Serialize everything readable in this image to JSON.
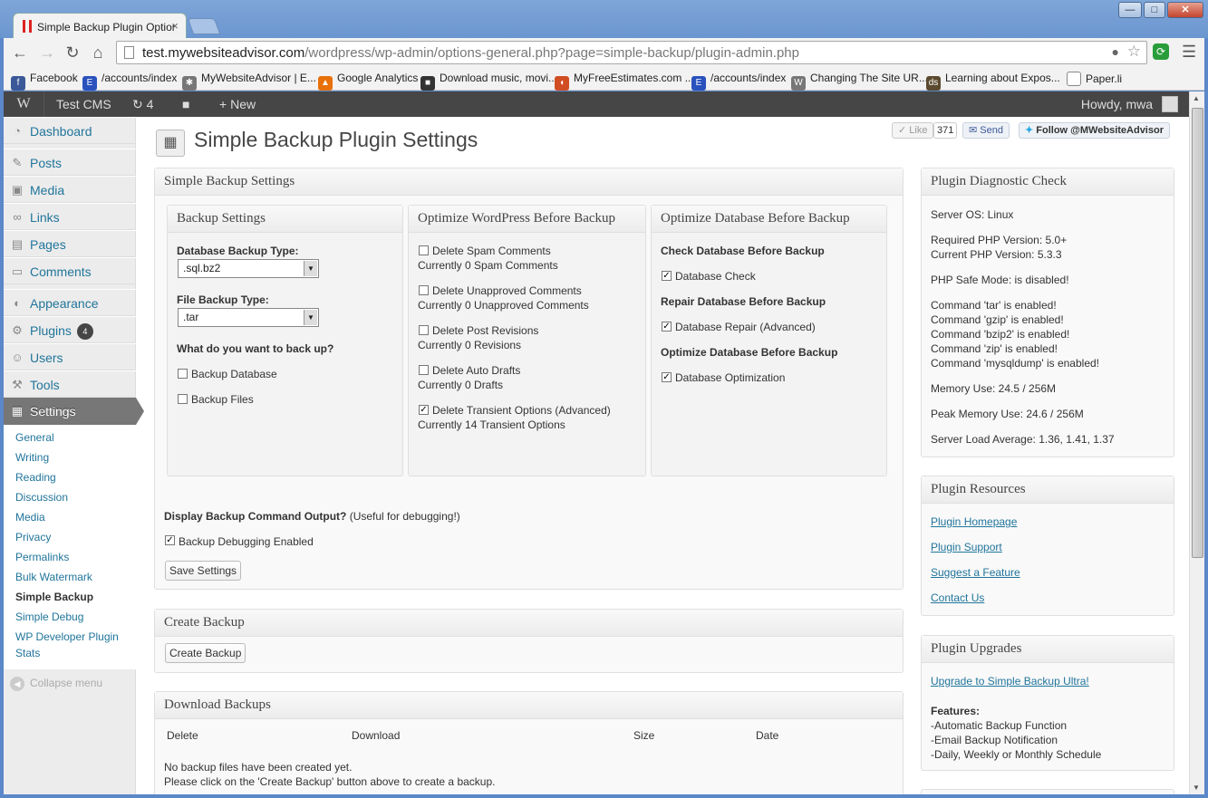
{
  "browser": {
    "tab_title": "Simple Backup Plugin Options",
    "tab_close": "×",
    "url_host": "test.mywebsiteadvisor.com",
    "url_path": "/wordpress/wp-admin/options-general.php?page=simple-backup/plugin-admin.php",
    "bookmarks": [
      {
        "label": "Facebook",
        "icon": "facebook-icon",
        "color": "#3b5998"
      },
      {
        "label": "/accounts/index",
        "icon": "e-icon",
        "color": "#2a52be"
      },
      {
        "label": "MyWebsiteAdvisor | E...",
        "icon": "gear-icon",
        "color": "#777777"
      },
      {
        "label": "Google Analytics",
        "icon": "analytics-icon",
        "color": "#e8710a"
      },
      {
        "label": "Download music, movi...",
        "icon": "pirate-icon",
        "color": "#333333"
      },
      {
        "label": "MyFreeEstimates.com ...",
        "icon": "estimates-icon",
        "color": "#d14d22"
      },
      {
        "label": "/accounts/index",
        "icon": "e-icon",
        "color": "#2a52be"
      },
      {
        "label": "Changing The Site UR...",
        "icon": "wordpress-icon",
        "color": "#777777"
      },
      {
        "label": "Learning about Expos...",
        "icon": "ds-icon",
        "color": "#5b4a2f"
      },
      {
        "label": "Paper.li",
        "icon": "page-icon",
        "color": "#ffffff"
      }
    ]
  },
  "adminbar": {
    "site_name": "Test CMS",
    "updates_count": "4",
    "new_label": "New",
    "howdy": "Howdy, mwa"
  },
  "sidebar": {
    "menu": [
      {
        "label": "Dashboard",
        "icon": "dashboard-icon"
      },
      {
        "label": "Posts",
        "icon": "pin-icon"
      },
      {
        "label": "Media",
        "icon": "media-icon"
      },
      {
        "label": "Links",
        "icon": "link-icon"
      },
      {
        "label": "Pages",
        "icon": "pages-icon"
      },
      {
        "label": "Comments",
        "icon": "comment-icon"
      },
      {
        "label": "Appearance",
        "icon": "appearance-icon"
      },
      {
        "label": "Plugins",
        "icon": "plugin-icon",
        "badge": "4"
      },
      {
        "label": "Users",
        "icon": "users-icon"
      },
      {
        "label": "Tools",
        "icon": "tools-icon"
      },
      {
        "label": "Settings",
        "icon": "settings-icon"
      }
    ],
    "submenu": [
      "General",
      "Writing",
      "Reading",
      "Discussion",
      "Media",
      "Privacy",
      "Permalinks",
      "Bulk Watermark",
      "Simple Backup",
      "Simple Debug",
      "WP Developer Plugin",
      "Stats"
    ],
    "collapse_label": "Collapse menu"
  },
  "header": {
    "title": "Simple Backup Plugin Settings",
    "like_label": "Like",
    "like_count": "371",
    "send_label": "Send",
    "follow_label": "Follow @MWebsiteAdvisor"
  },
  "settings_box": {
    "title": "Simple Backup Settings",
    "backup": {
      "title": "Backup Settings",
      "db_type_label": "Database Backup Type:",
      "db_type_value": ".sql.bz2",
      "file_type_label": "File Backup Type:",
      "file_type_value": ".tar",
      "what_label": "What do you want to back up?",
      "opt_database": "Backup Database",
      "opt_files": "Backup Files"
    },
    "optimize_wp": {
      "title": "Optimize WordPress Before Backup",
      "items": [
        {
          "label": "Delete Spam Comments",
          "note": "Currently 0 Spam Comments",
          "checked": false
        },
        {
          "label": "Delete Unapproved Comments",
          "note": "Currently 0 Unapproved Comments",
          "checked": false
        },
        {
          "label": "Delete Post Revisions",
          "note": "Currently 0 Revisions",
          "checked": false
        },
        {
          "label": "Delete Auto Drafts",
          "note": "Currently 0 Drafts",
          "checked": false
        },
        {
          "label": "Delete Transient Options (Advanced)",
          "note": "Currently 14 Transient Options",
          "checked": true
        }
      ]
    },
    "optimize_db": {
      "title": "Optimize Database Before Backup",
      "check_heading": "Check Database Before Backup",
      "check_label": "Database Check",
      "repair_heading": "Repair Database Before Backup",
      "repair_label": "Database Repair (Advanced)",
      "optimize_heading": "Optimize Database Before Backup",
      "optimize_label": "Database Optimization"
    },
    "debug_label": "Display Backup Command Output?",
    "debug_hint": "(Useful for debugging!)",
    "debug_checkbox": "Backup Debugging Enabled",
    "save_button": "Save Settings"
  },
  "create_box": {
    "title": "Create Backup",
    "button": "Create Backup"
  },
  "download_box": {
    "title": "Download Backups",
    "columns": [
      "Delete",
      "Download",
      "Size",
      "Date"
    ],
    "empty_line1": "No backup files have been created yet.",
    "empty_line2": "Please click on the 'Create Backup' button above to create a backup."
  },
  "diagnostic": {
    "title": "Plugin Diagnostic Check",
    "server_os": "Server OS: Linux",
    "php_required": "Required PHP Version: 5.0+",
    "php_current": "Current PHP Version: 5.3.3",
    "safe_mode": "PHP Safe Mode: is disabled!",
    "commands": [
      "Command 'tar' is enabled!",
      "Command 'gzip' is enabled!",
      "Command 'bzip2' is enabled!",
      "Command 'zip' is enabled!",
      "Command 'mysqldump' is enabled!"
    ],
    "memory": "Memory Use: 24.5 / 256M",
    "peak_memory": "Peak Memory Use: 24.6 / 256M",
    "load": "Server Load Average: 1.36, 1.41, 1.37"
  },
  "resources": {
    "title": "Plugin Resources",
    "links": [
      "Plugin Homepage",
      "Plugin Support",
      "Suggest a Feature",
      "Contact Us"
    ]
  },
  "upgrades": {
    "title": "Plugin Upgrades",
    "link": "Upgrade to Simple Backup Ultra!",
    "features_label": "Features:",
    "features": [
      "-Automatic Backup Function",
      "-Email Backup Notification",
      "-Daily, Weekly or Monthly Schedule"
    ]
  }
}
